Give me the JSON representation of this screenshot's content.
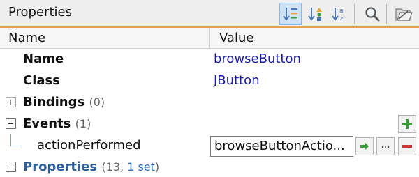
{
  "panel": {
    "title": "Properties",
    "toolbar": {
      "buttons": [
        {
          "icon": "sort-categorized-icon",
          "pressed": true
        },
        {
          "icon": "sort-by-kind-icon",
          "pressed": false
        },
        {
          "icon": "sort-alphabetical-icon",
          "pressed": false
        },
        {
          "icon": "search-icon",
          "pressed": false
        },
        {
          "icon": "hide-expert-properties-icon",
          "pressed": false
        }
      ]
    },
    "columns": {
      "name": "Name",
      "value": "Value"
    },
    "rows": {
      "name": {
        "label": "Name",
        "value": "browseButton"
      },
      "class": {
        "label": "Class",
        "value": "JButton"
      },
      "bindings": {
        "label": "Bindings",
        "count": "(0)",
        "expanded": false
      },
      "events": {
        "label": "Events",
        "count": "(1)",
        "expanded": true
      },
      "action_performed": {
        "label": "actionPerformed",
        "value": "browseButtonActio..."
      },
      "properties": {
        "label": "Properties",
        "count_prefix": "(13, ",
        "count_link": "1 set",
        "count_suffix": ")",
        "expanded": true
      }
    },
    "colors": {
      "accent_underline": "#e8a050",
      "value_text": "#1a1aa6",
      "properties_label": "#2f5f9a",
      "add_green": "#3a9a3a",
      "remove_red": "#cc3333"
    }
  }
}
